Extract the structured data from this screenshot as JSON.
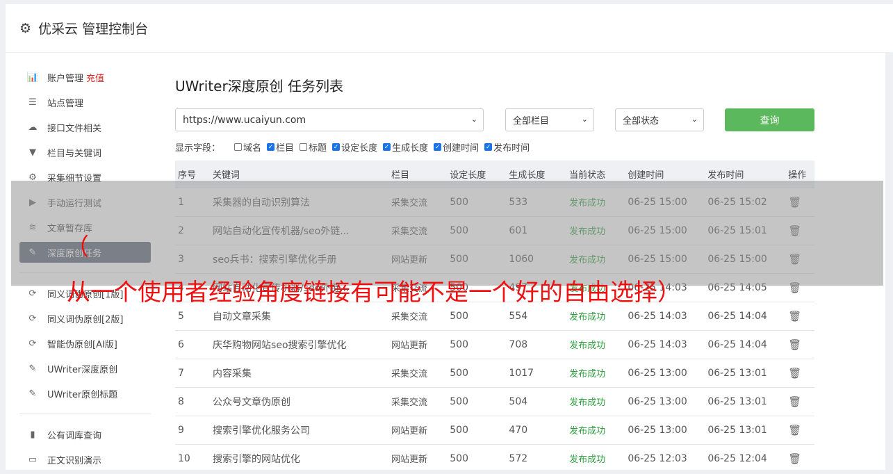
{
  "header": {
    "title": "优采云 管理控制台"
  },
  "sidebar": {
    "items": [
      {
        "label": "账户管理",
        "icon": "bar-chart-icon",
        "glyph": "📊",
        "extra": "充值"
      },
      {
        "label": "站点管理",
        "icon": "server-icon",
        "glyph": "☰"
      },
      {
        "label": "接口文件相关",
        "icon": "cloud-upload-icon",
        "glyph": "☁"
      },
      {
        "label": "栏目与关键词",
        "icon": "filter-icon",
        "glyph": "▼"
      },
      {
        "label": "采集细节设置",
        "icon": "gears-icon",
        "glyph": "⚙"
      },
      {
        "label": "手动运行测试",
        "icon": "play-icon",
        "glyph": "▶"
      },
      {
        "label": "文章暂存库",
        "icon": "database-icon",
        "glyph": "≋"
      },
      {
        "label": "深度原创任务",
        "icon": "edit-icon",
        "glyph": "✎",
        "active": true
      }
    ],
    "items2": [
      {
        "label": "同义词伪原创[1版]",
        "icon": "refresh-icon",
        "glyph": "⟳"
      },
      {
        "label": "同义词伪原创[2版]",
        "icon": "refresh-icon",
        "glyph": "⟳"
      },
      {
        "label": "智能伪原创[AI版]",
        "icon": "refresh-icon",
        "glyph": "⟳"
      },
      {
        "label": "UWriter深度原创",
        "icon": "edit-icon",
        "glyph": "✎"
      },
      {
        "label": "UWriter原创标题",
        "icon": "edit-icon",
        "glyph": "✎"
      }
    ],
    "items3": [
      {
        "label": "公有词库查询",
        "icon": "book-icon",
        "glyph": "▮"
      },
      {
        "label": "正文识别演示",
        "icon": "monitor-icon",
        "glyph": "▭"
      }
    ]
  },
  "main": {
    "title": "UWriter深度原创 任务列表",
    "url_value": "https://www.ucaiyun.com",
    "column_select": "全部栏目",
    "status_select": "全部状态",
    "query_label": "查询",
    "fields_label": "显示字段：",
    "fields": [
      {
        "label": "域名",
        "checked": false
      },
      {
        "label": "栏目",
        "checked": true
      },
      {
        "label": "标题",
        "checked": false
      },
      {
        "label": "设定长度",
        "checked": true
      },
      {
        "label": "生成长度",
        "checked": true
      },
      {
        "label": "创建时间",
        "checked": true
      },
      {
        "label": "发布时间",
        "checked": true
      }
    ],
    "columns": [
      "序号",
      "关键词",
      "栏目",
      "设定长度",
      "生成长度",
      "当前状态",
      "创建时间",
      "发布时间",
      "操作"
    ],
    "rows": [
      [
        "1",
        "采集器的自动识别算法",
        "采集交流",
        "500",
        "533",
        "发布成功",
        "06-25 15:00",
        "06-25 15:02"
      ],
      [
        "2",
        "网站自动化宣传机器/seo外链...",
        "采集交流",
        "500",
        "601",
        "发布成功",
        "06-25 15:00",
        "06-25 15:01"
      ],
      [
        "3",
        "seo兵书：搜索引擎优化手册",
        "网站更新",
        "500",
        "1060",
        "发布成功",
        "06-25 15:00",
        "06-25 15:00"
      ],
      [
        "4",
        "网站自动化宣传机器/seo外链...",
        "采集交流",
        "500",
        "497",
        "发布成功",
        "06-25 14:03",
        "06-25 14:05"
      ],
      [
        "5",
        "自动文章采集",
        "采集交流",
        "500",
        "554",
        "发布成功",
        "06-25 14:03",
        "06-25 14:04"
      ],
      [
        "6",
        "庆华购物网站seo搜索引擎优化",
        "网站更新",
        "500",
        "708",
        "发布成功",
        "06-25 14:03",
        "06-25 14:04"
      ],
      [
        "7",
        "内容采集",
        "采集交流",
        "500",
        "1017",
        "发布成功",
        "06-25 13:00",
        "06-25 13:01"
      ],
      [
        "8",
        "公众号文章伪原创",
        "采集交流",
        "500",
        "504",
        "发布成功",
        "06-25 13:00",
        "06-25 13:01"
      ],
      [
        "9",
        "搜索引擎优化服务公司",
        "网站更新",
        "500",
        "470",
        "发布成功",
        "06-25 13:00",
        "06-25 13:01"
      ],
      [
        "10",
        "搜索引擎的网站优化",
        "网站更新",
        "500",
        "572",
        "发布成功",
        "06-25 12:03",
        "06-25 12:04"
      ]
    ]
  },
  "overlay": {
    "paren": "（",
    "text": "从一个使用者经验角度链接有可能不是一个好的自由选择）"
  },
  "colors": {
    "accent_green": "#5cb85c",
    "active_nav": "#5b6478",
    "success_text": "#2e9e3f",
    "banner_red": "#ee1111"
  }
}
